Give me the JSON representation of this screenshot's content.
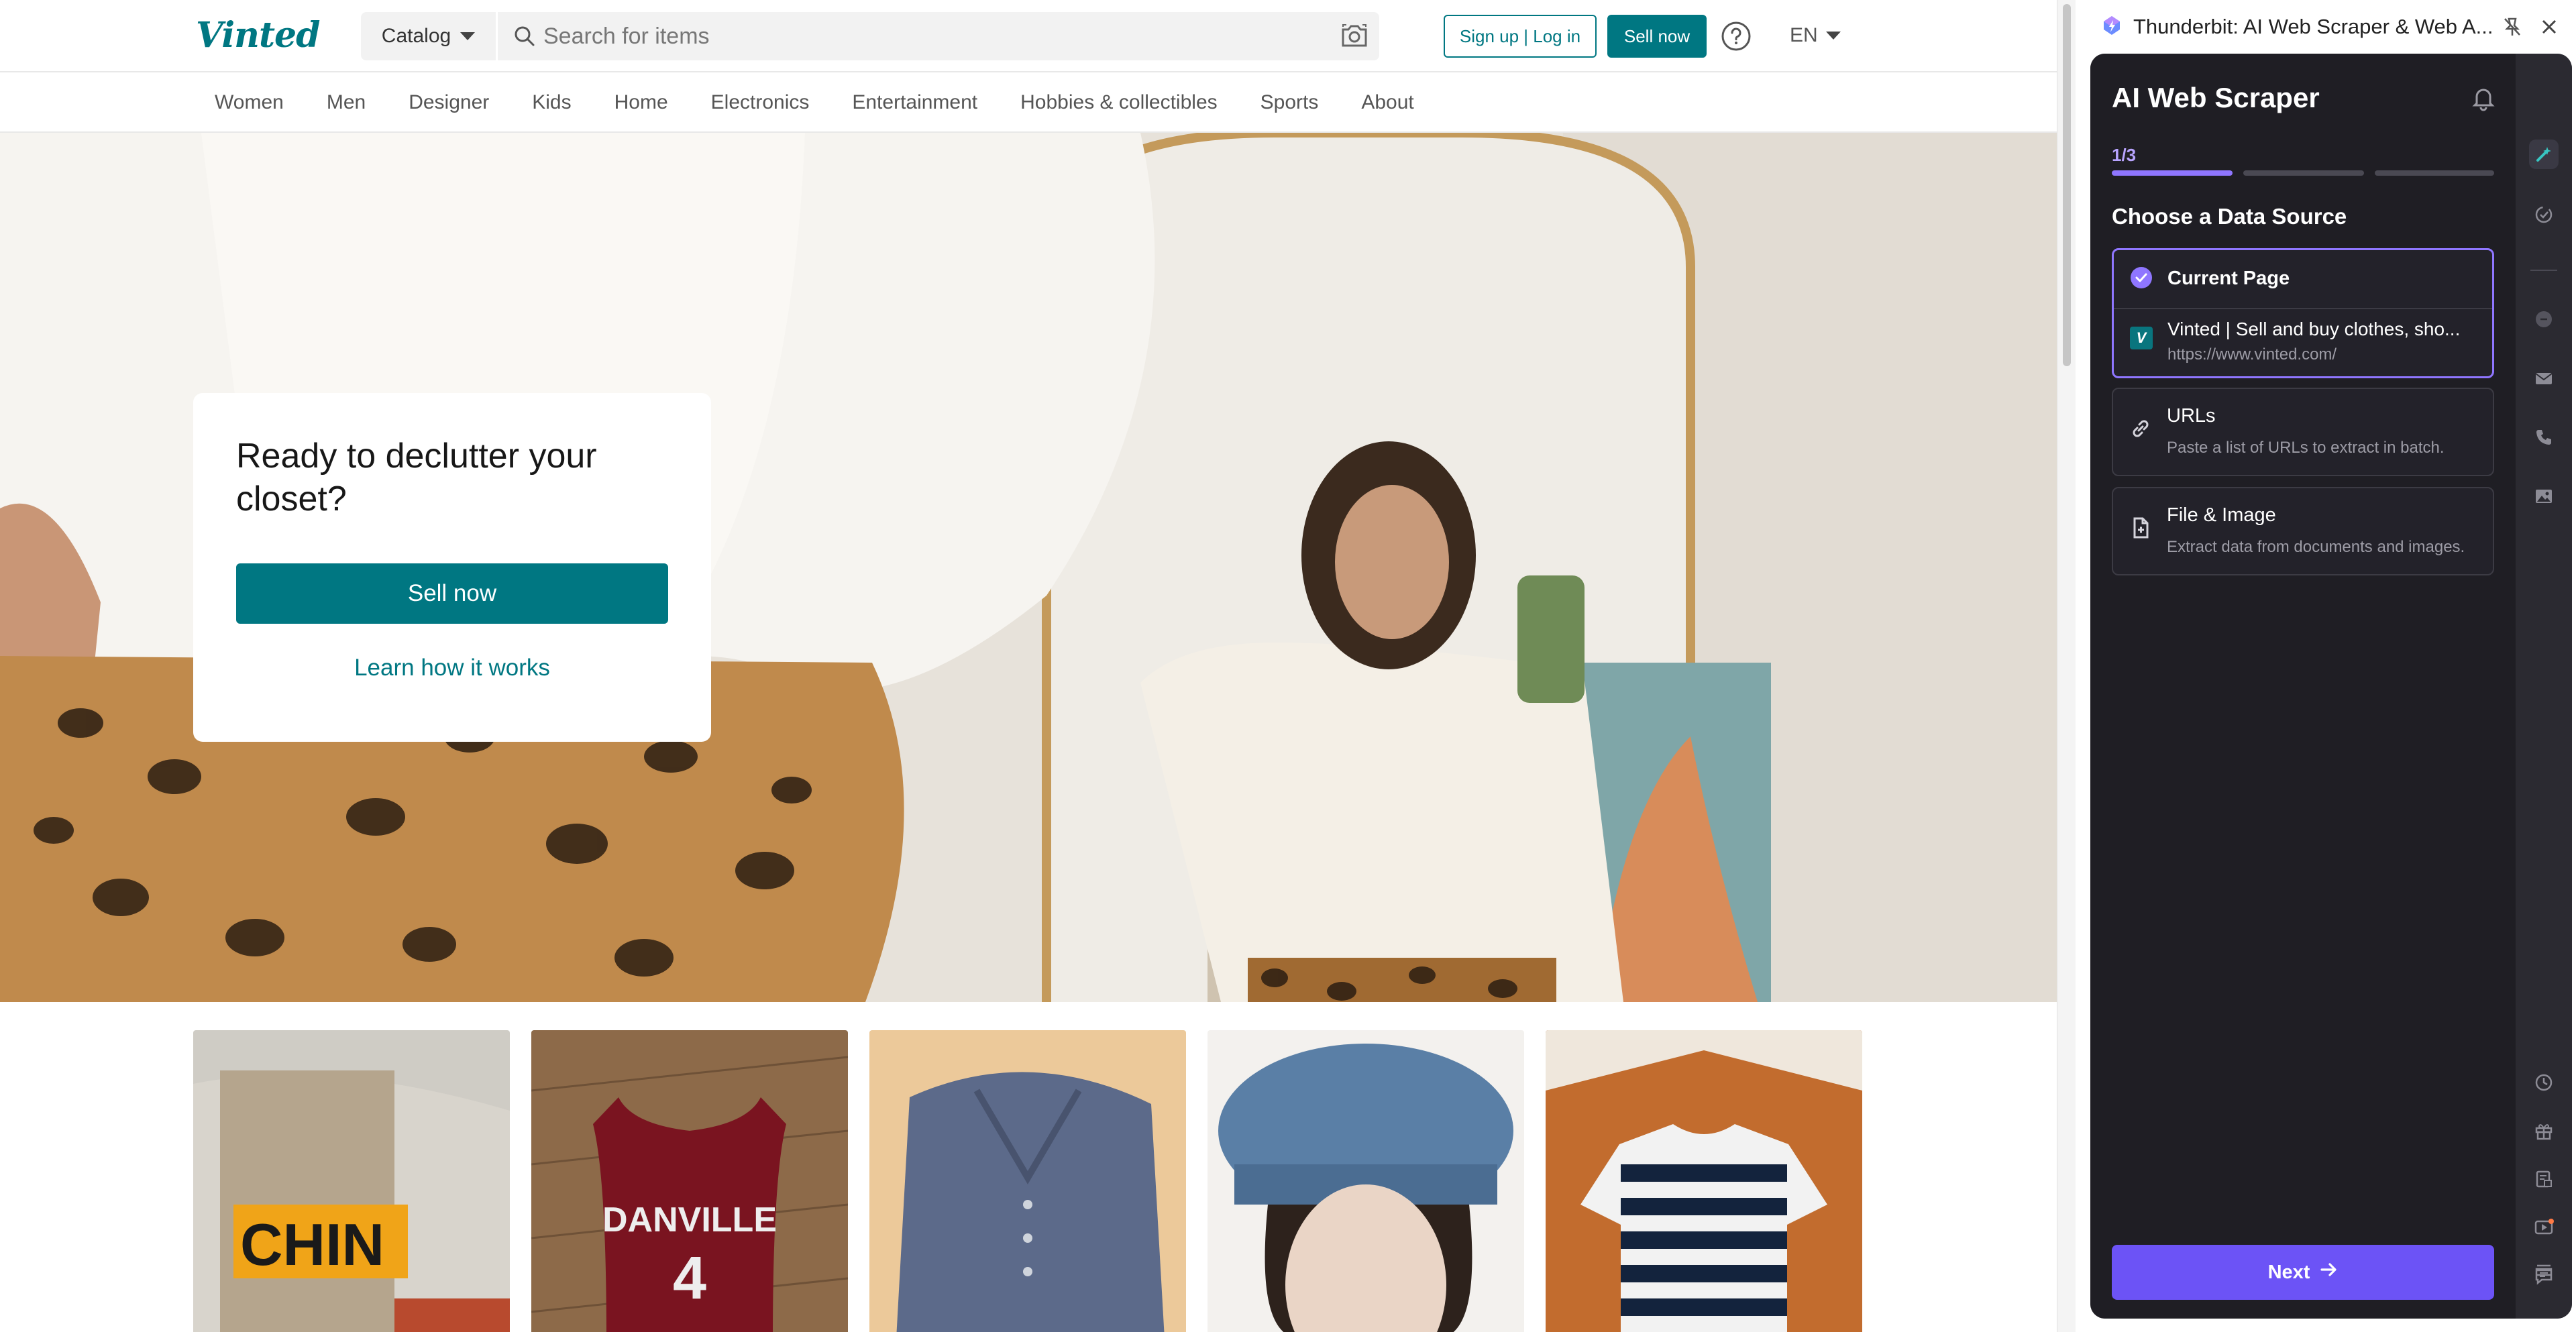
{
  "vinted": {
    "logo": "Vinted",
    "catalog_label": "Catalog",
    "search_placeholder": "Search for items",
    "signup_label": "Sign up | Log in",
    "sell_label": "Sell now",
    "lang": "EN",
    "nav": [
      "Women",
      "Men",
      "Designer",
      "Kids",
      "Home",
      "Electronics",
      "Entertainment",
      "Hobbies & collectibles",
      "Sports",
      "About"
    ],
    "hero": {
      "title": "Ready to declutter your closet?",
      "cta": "Sell now",
      "link": "Learn how it works"
    },
    "brand_color": "#007782"
  },
  "extension": {
    "window_title": "Thunderbit: AI Web Scraper & Web A...",
    "heading": "AI Web Scraper",
    "step": "1/3",
    "section_title": "Choose a Data Source",
    "options": [
      {
        "title": "Current Page",
        "page_title": "Vinted | Sell and buy clothes, sho...",
        "page_url": "https://www.vinted.com/",
        "favicon": "V"
      },
      {
        "title": "URLs",
        "desc": "Paste a list of URLs to extract in batch."
      },
      {
        "title": "File & Image",
        "desc": "Extract data from documents and images."
      }
    ],
    "next_label": "Next",
    "accent": "#6c53f6"
  }
}
